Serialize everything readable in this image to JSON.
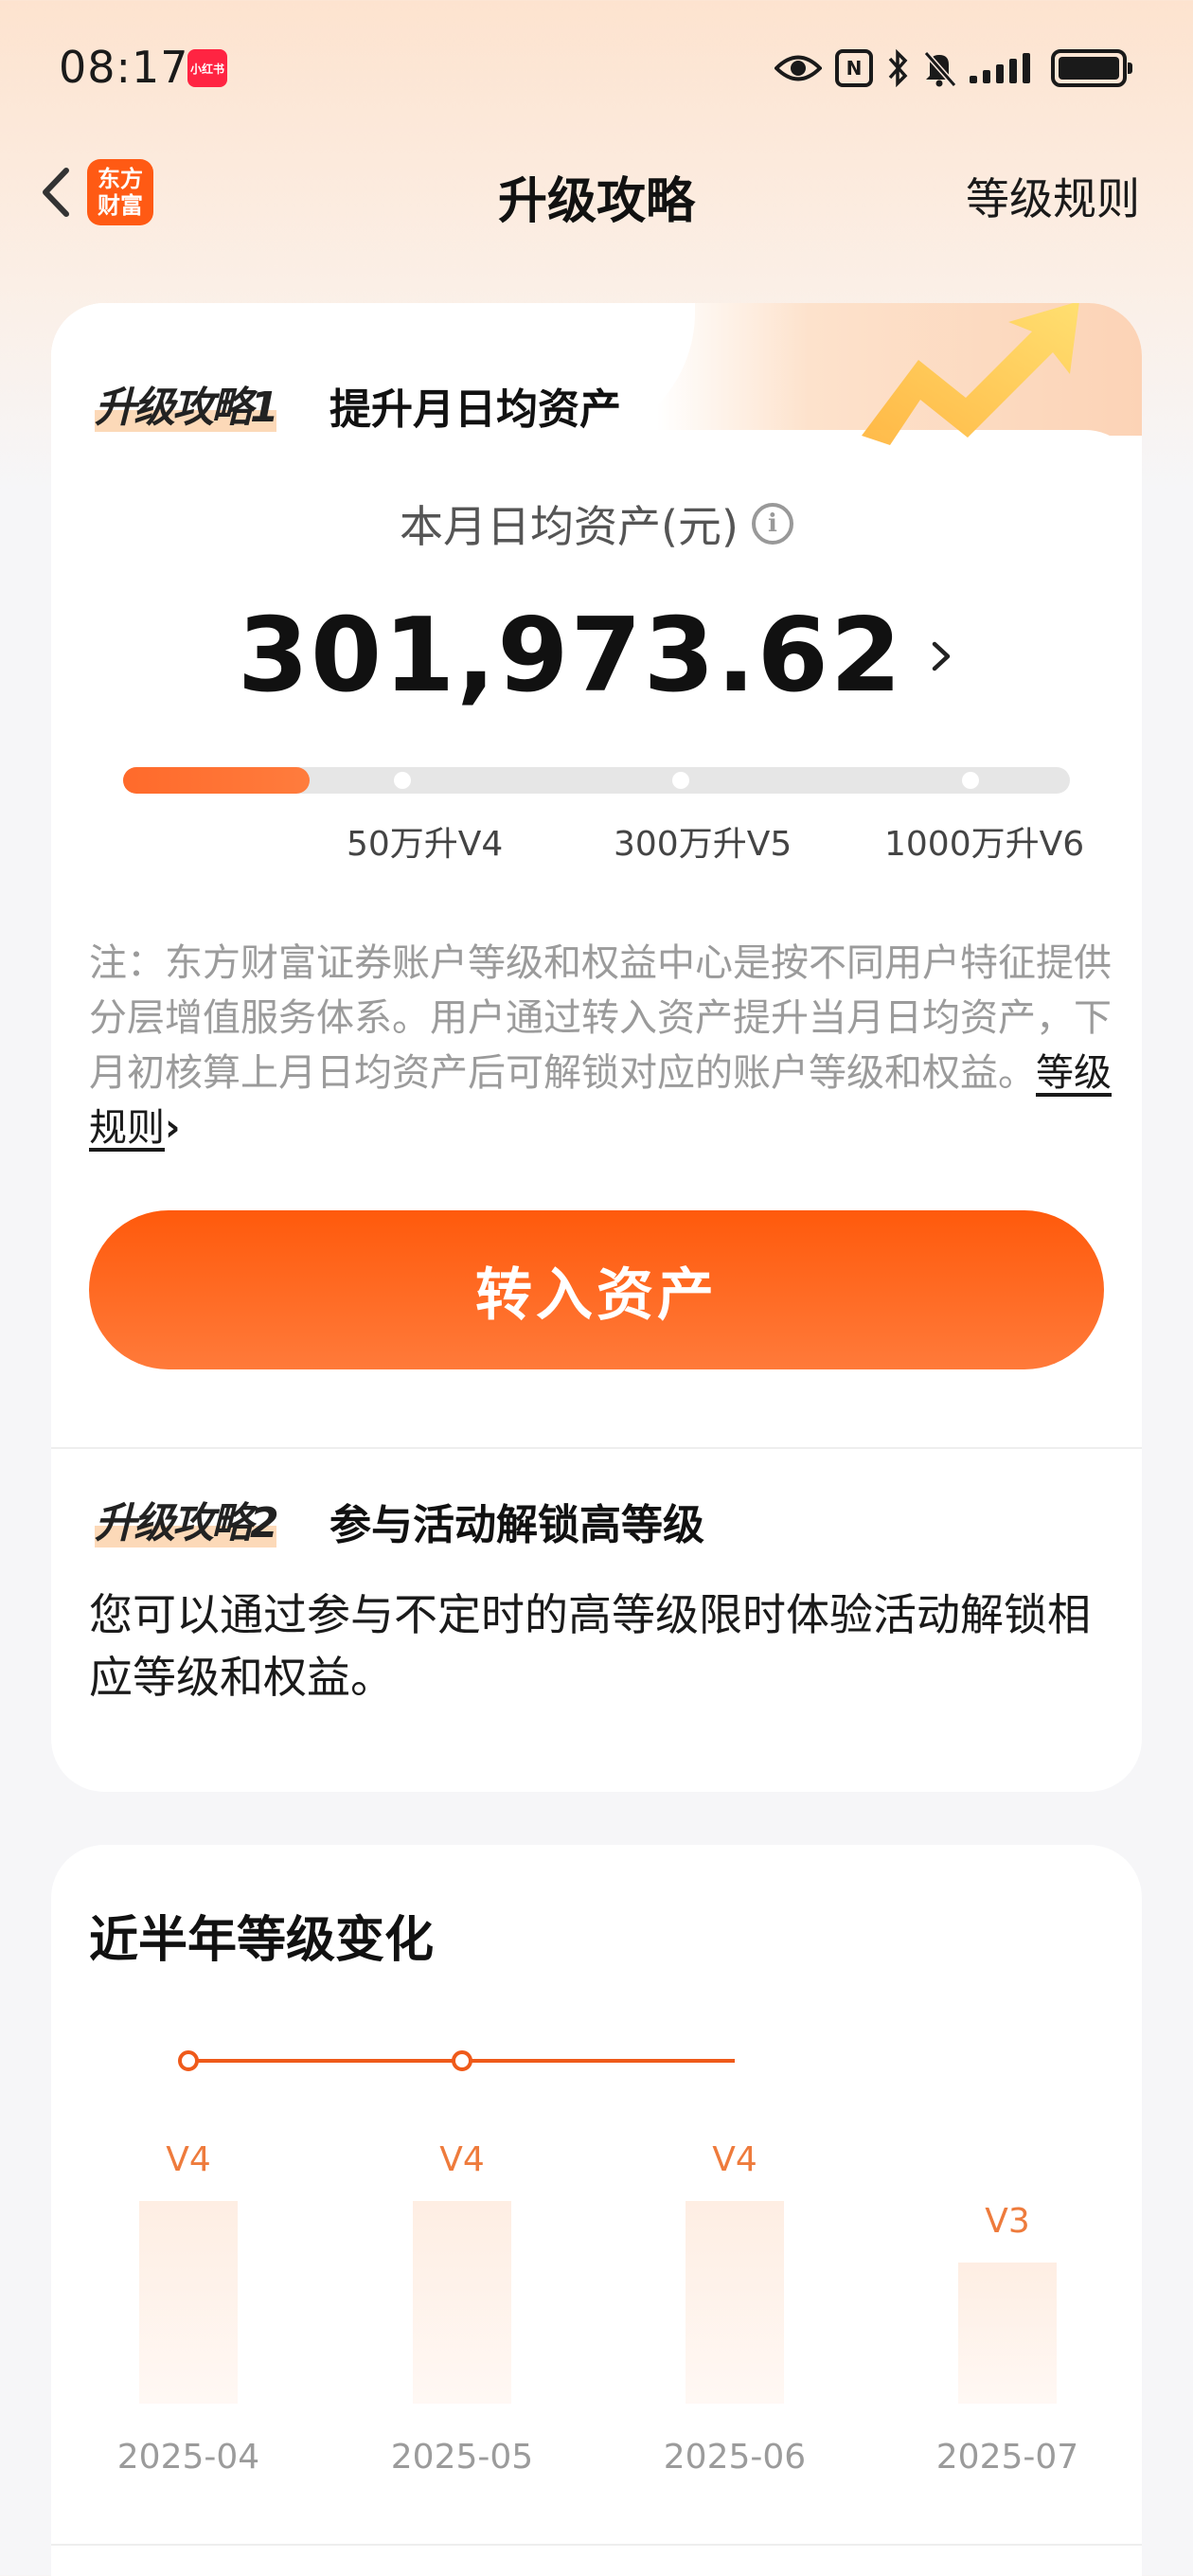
{
  "status_bar": {
    "time": "08:17",
    "app_badge": "小红书",
    "icons": [
      "eye-icon",
      "nfc-icon",
      "bluetooth-icon",
      "mute-bell-icon",
      "signal-icon",
      "battery-icon"
    ]
  },
  "nav": {
    "logo_text": "东方财富",
    "title": "升级攻略",
    "rules_link": "等级规则"
  },
  "strategy1": {
    "tag": "升级攻略1",
    "title": "提升月日均资产",
    "asset_label": "本月日均资产(元)",
    "asset_value": "301,973.62",
    "progress": {
      "fraction": 0.197,
      "milestones": [
        "50万升V4",
        "300万升V5",
        "1000万升V6"
      ]
    },
    "note": "注：东方财富证券账户等级和权益中心是按不同用户特征提供分层增值服务体系。用户通过转入资产提升当月日均资产，下月初核算上月日均资产后可解锁对应的账户等级和权益。",
    "note_link": "等级规则",
    "button_label": "转入资产"
  },
  "strategy2": {
    "tag": "升级攻略2",
    "title": "参与活动解锁高等级",
    "description": "您可以通过参与不定时的高等级限时体验活动解锁相应等级和权益。"
  },
  "level_history": {
    "title": "近半年等级变化",
    "chart_data": {
      "type": "bar",
      "categories": [
        "2025-04",
        "2025-05",
        "2025-06",
        "2025-07"
      ],
      "values": [
        4,
        4,
        4,
        3
      ],
      "value_labels": [
        "V4",
        "V4",
        "V4",
        "V3"
      ]
    }
  },
  "colors": {
    "accent": "#ff5a0c",
    "accent_light": "#ff7a3a",
    "level_label": "#ee7b3c",
    "muted_text": "#9b9b9b"
  }
}
